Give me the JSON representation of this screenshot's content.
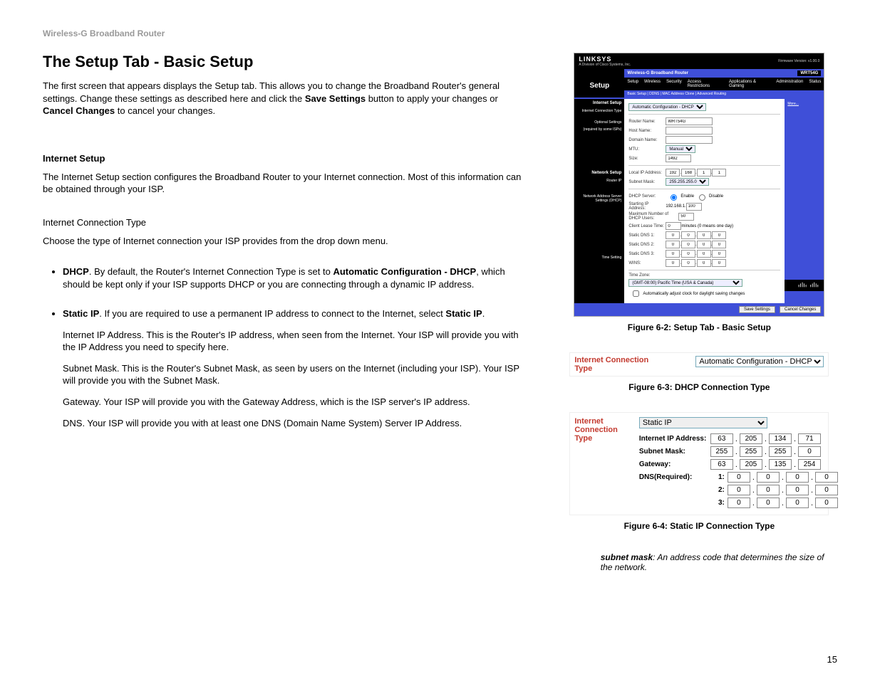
{
  "header": "Wireless-G Broadband Router",
  "title": "The Setup Tab - Basic Setup",
  "intro_1": "The first screen that appears displays the Setup tab. This allows you to change the Broadband Router's general settings. Change these settings as described here and click the ",
  "intro_save": "Save Settings",
  "intro_2": " button to apply your changes or ",
  "intro_cancel": "Cancel Changes",
  "intro_3": " to cancel your changes.",
  "section_internet_setup": "Internet Setup",
  "internet_setup_p": "The Internet Setup section configures the Broadband Router to your Internet connection. Most of this information can be obtained through your ISP.",
  "sub_ict": "Internet Connection Type",
  "ict_p": "Choose the type of Internet connection your ISP provides from the drop down menu.",
  "bullet_dhcp_b": "DHCP",
  "bullet_dhcp_1": ". By default, the Router's Internet Connection Type is set to ",
  "bullet_dhcp_b2": "Automatic Configuration - DHCP",
  "bullet_dhcp_2": ", which should be kept only if your ISP supports DHCP or you are connecting through a dynamic IP address.",
  "bullet_static_b": "Static IP",
  "bullet_static_1": ". If you are required to use a permanent IP address to connect to the Internet, select ",
  "bullet_static_b2": "Static IP",
  "bullet_static_2": ".",
  "static_sub1": "Internet IP Address. This is the Router's IP address, when seen from the Internet. Your ISP will provide you with the IP Address you need to specify here.",
  "static_sub2": "Subnet Mask. This is the Router's Subnet Mask, as seen by users on the Internet (including your ISP). Your ISP will provide you with the Subnet Mask.",
  "static_sub3": "Gateway. Your ISP will provide you with the Gateway Address, which is the ISP server's IP address.",
  "static_sub4": "DNS. Your ISP will provide you with at least one DNS (Domain Name System) Server IP Address.",
  "fig62_caption": "Figure 6-2: Setup Tab - Basic Setup",
  "fig63_caption": "Figure 6-3: DHCP Connection Type",
  "fig64_caption": "Figure 6-4: Static IP Connection Type",
  "glossary_term": "subnet mask",
  "glossary_def": ": An address code that determines the size of the network.",
  "page_number": "15",
  "ict_label": "Internet Connection Type",
  "dhcp_option": "Automatic Configuration - DHCP",
  "static_option": "Static IP",
  "router": {
    "brand": "LINKSYS",
    "brand_sub": "A Division of Cisco Systems, Inc.",
    "firmware": "Firmware Version: v1.00.0",
    "product_name": "Wireless-G Broadband Router",
    "model": "WRT54G",
    "tab": "Setup",
    "tabs": [
      "Setup",
      "Wireless",
      "Security",
      "Access Restrictions",
      "Applications & Gaming",
      "Administration",
      "Status"
    ],
    "subtabs": "Basic Setup    |    DDNS    |    MAC Address Clone    |    Advanced Routing",
    "sec_internet": "Internet Setup",
    "lbl_ict": "Internet Connection Type",
    "val_ict": "Automatic Configuration - DHCP",
    "lbl_optional": "Optional Settings",
    "lbl_optional2": "(required by some ISPs)",
    "lbl_router_name": "Router Name:",
    "val_router_name": "WRT54G",
    "lbl_host": "Host Name:",
    "lbl_domain": "Domain Name:",
    "lbl_mtu": "MTU:",
    "val_mtu_mode": "Manual",
    "lbl_size": "Size:",
    "val_size": "1492",
    "sec_network": "Network Setup",
    "lbl_router_ip": "Router IP",
    "lbl_local_ip": "Local IP Address:",
    "val_local_ip": [
      "192",
      "168",
      "1",
      "1"
    ],
    "lbl_subnet": "Subnet Mask:",
    "val_subnet": "255.255.255.0",
    "lbl_nas": "Network Address Server Settings (DHCP)",
    "lbl_dhcp_server": "DHCP Server:",
    "opt_enable": "Enable",
    "opt_disable": "Disable",
    "lbl_start_ip": "Starting IP Address:",
    "val_start_ip_prefix": "192.168.1.",
    "val_start_ip": "100",
    "lbl_max_users": "Maximum Number of DHCP Users:",
    "val_max_users": "50",
    "lbl_lease": "Client Lease Time:",
    "val_lease": "0",
    "lease_hint": "minutes (0 means one day)",
    "lbl_sdns1": "Static DNS 1:",
    "lbl_sdns2": "Static DNS 2:",
    "lbl_sdns3": "Static DNS 3:",
    "lbl_wins": "WINS:",
    "zero_ip": [
      "0",
      "0",
      "0",
      "0"
    ],
    "sec_time": "Time Setting",
    "lbl_tz": "Time Zone:",
    "val_tz": "(GMT-08:00) Pacific Time (USA & Canada)",
    "cb_dst": "Automatically adjust clock for daylight saving changes",
    "btn_save": "Save Settings",
    "btn_cancel": "Cancel Changes",
    "more": "More...",
    "cisco": "CISCO SYSTEMS"
  },
  "static_fields": {
    "ip_label": "Internet IP Address:",
    "subnet_label": "Subnet Mask:",
    "gateway_label": "Gateway:",
    "dns_label": "DNS(Required):",
    "ip": [
      "63",
      "205",
      "134",
      "71"
    ],
    "subnet": [
      "255",
      "255",
      "255",
      "0"
    ],
    "gateway": [
      "63",
      "205",
      "135",
      "254"
    ],
    "dns1": [
      "0",
      "0",
      "0",
      "0"
    ],
    "dns2": [
      "0",
      "0",
      "0",
      "0"
    ],
    "dns3": [
      "0",
      "0",
      "0",
      "0"
    ]
  }
}
